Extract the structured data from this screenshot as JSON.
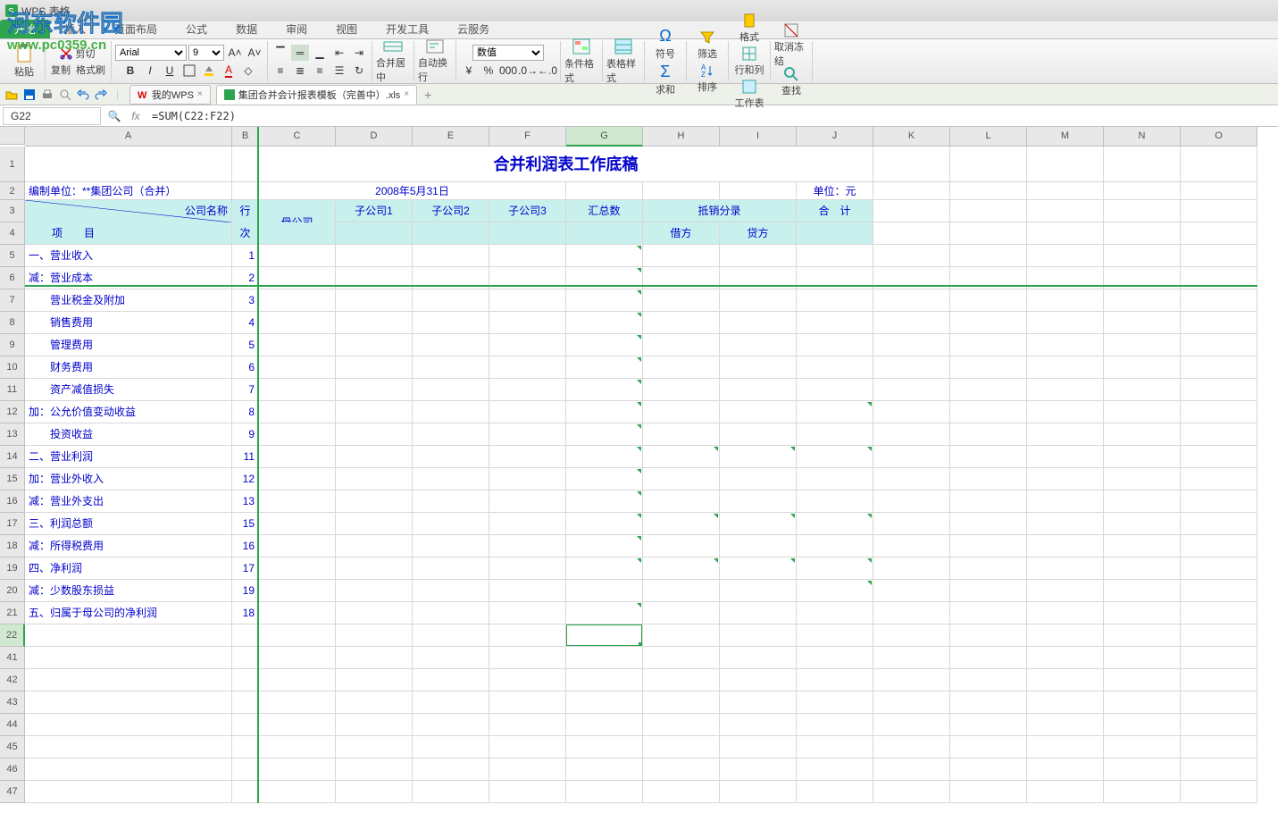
{
  "app": {
    "title": "WPS 表格"
  },
  "watermark": {
    "line1": "河东软件园",
    "line2": "www.pc0359.cn"
  },
  "menu": {
    "items": [
      "开始",
      "插入",
      "页面布局",
      "公式",
      "数据",
      "审阅",
      "视图",
      "开发工具",
      "云服务"
    ],
    "active": 0
  },
  "ribbon": {
    "paste": "粘贴",
    "cut": "剪切",
    "copy": "复制",
    "fmtpaint": "格式刷",
    "font": "Arial",
    "size": "9",
    "merge": "合并居中",
    "wrap": "自动换行",
    "numfmt": "数值",
    "condfmt": "条件格式",
    "tblstyle": "表格样式",
    "symbol": "符号",
    "sum": "求和",
    "filter": "筛选",
    "sort": "排序",
    "format": "格式",
    "rowcol": "行和列",
    "sheet": "工作表",
    "freeze": "取消冻结",
    "find": "查找"
  },
  "docs": {
    "tab1": "我的WPS",
    "tab2": "集团合并会计报表模板（完善中）.xls"
  },
  "formula": {
    "cellref": "G22",
    "content": "=SUM(C22:F22)"
  },
  "columns": [
    "A",
    "B",
    "C",
    "D",
    "E",
    "F",
    "G",
    "H",
    "I",
    "J",
    "K",
    "L",
    "M",
    "N",
    "O"
  ],
  "sheet": {
    "title": "合并利润表工作底稿",
    "org": "编制单位：**集团公司（合并）",
    "date": "2008年5月31日",
    "unit": "单位：元",
    "h_company": "公司名称",
    "h_row": "行",
    "h_item": "项　　目",
    "h_rownum": "次",
    "h_parent": "母公司",
    "h_sub1": "子公司1",
    "h_sub2": "子公司2",
    "h_sub3": "子公司3",
    "h_total": "汇总数",
    "h_elim": "抵销分录",
    "h_debit": "借方",
    "h_credit": "贷方",
    "h_merge": "合　计",
    "rows": [
      {
        "label": "一、营业收入",
        "n": "1"
      },
      {
        "label": "减：营业成本",
        "n": "2"
      },
      {
        "label": "　　营业税金及附加",
        "n": "3"
      },
      {
        "label": "　　销售费用",
        "n": "4"
      },
      {
        "label": "　　管理费用",
        "n": "5"
      },
      {
        "label": "　　财务费用",
        "n": "6"
      },
      {
        "label": "　　资产减值损失",
        "n": "7"
      },
      {
        "label": "加：公允价值变动收益",
        "n": "8"
      },
      {
        "label": "　　投资收益",
        "n": "9"
      },
      {
        "label": "二、营业利润",
        "n": "11"
      },
      {
        "label": "加：营业外收入",
        "n": "12"
      },
      {
        "label": "减：营业外支出",
        "n": "13"
      },
      {
        "label": "三、利润总额",
        "n": "15"
      },
      {
        "label": "减：所得税费用",
        "n": "16"
      },
      {
        "label": "四、净利润",
        "n": "17"
      },
      {
        "label": "减：少数股东损益",
        "n": "19"
      },
      {
        "label": "五、归属于母公司的净利润",
        "n": "18"
      }
    ]
  }
}
